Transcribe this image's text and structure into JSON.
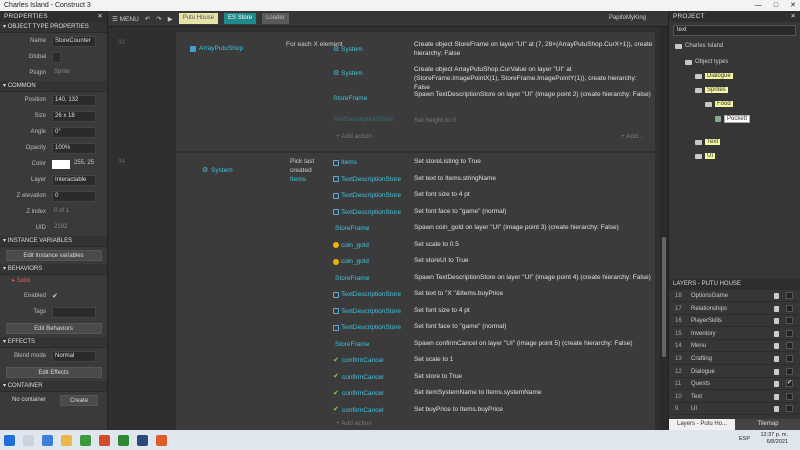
{
  "window": {
    "title": "Charles Island - Construct 3",
    "controls": [
      "—",
      "□",
      "✕"
    ]
  },
  "properties": {
    "header": "PROPERTIES",
    "sections": {
      "object_type": "OBJECT TYPE PROPERTIES",
      "common": "COMMON",
      "instance_vars": "INSTANCE VARIABLES",
      "behaviors": "BEHAVIORS",
      "effects": "EFFECTS",
      "container": "CONTAINER"
    },
    "name_label": "Name",
    "name_value": "StoreCounter",
    "global_label": "Global",
    "plugin_label": "Plugin",
    "plugin_value": "Sprite",
    "position_label": "Position",
    "position_value": "140, 132",
    "size_label": "Size",
    "size_value": "26 x 18",
    "angle_label": "Angle",
    "angle_value": "0°",
    "opacity_label": "Opacity",
    "opacity_value": "100%",
    "color_label": "Color",
    "color_value": "255, 25",
    "layer_label": "Layer",
    "layer_value": "Interactable",
    "zelev_label": "Z elevation",
    "zelev_value": "0",
    "zindex_label": "Z index",
    "zindex_value": "0 of 1",
    "uid_label": "UID",
    "uid_value": "2192",
    "edit_instance_vars": "Edit Instance variables",
    "behavior_name": "Solid",
    "enabled_label": "Enabled",
    "tags_label": "Tags",
    "edit_behaviors": "Edit Behaviors",
    "blend_label": "Blend mode",
    "blend_value": "Normal",
    "edit_effects": "Edit Effects",
    "no_container": "No container",
    "create": "Create"
  },
  "toolbar": {
    "menu": "MENU",
    "tabs": [
      "Putu House",
      "ES Store",
      "Loader"
    ],
    "user": "PapitoMyKing"
  },
  "events": {
    "ev33_num": "33",
    "ev34_num": "34",
    "ev33_cond_object": "ArrayPutuShop",
    "ev33_cond_text": "For each X element",
    "ev34_cond_object": "System",
    "ev34_cond_text": "Pick last created",
    "ev34_cond_target": "Items",
    "add_action": "+ Add action",
    "add": "+ Add...",
    "ev33_actions": [
      {
        "object": "System",
        "text": "Create object StoreFrame on layer \"UI\" at (7, 28×(ArrayPutuShop.CurX+1)), create hierarchy: False"
      },
      {
        "object": "System",
        "text": "Create object ArrayPutuShop.CurValue on layer \"UI\" at (StoreFrame.ImagePointX(1), StoreFrame.ImagePointY(1)), create hierarchy: False"
      },
      {
        "object": "StoreFrame",
        "text": "Spawn TextDescriptionStore on layer \"UI\" (image point 2) (create hierarchy: False)"
      },
      {
        "object": "TextDescriptionStore",
        "text": "Set height to 0"
      }
    ],
    "ev34_actions": [
      {
        "object": "Items",
        "text": "Set storeListing to True"
      },
      {
        "object": "TextDescriptionStore",
        "text": "Set text to Items.stringName"
      },
      {
        "object": "TextDescriptionStore",
        "text": "Set font size to 4 pt"
      },
      {
        "object": "TextDescriptionStore",
        "text": "Set font face to \"game\" (normal)"
      },
      {
        "object": "StoreFrame",
        "text": "Spawn coin_gold on layer \"UI\" (image point 3) (create hierarchy: False)"
      },
      {
        "object": "coin_gold",
        "text": "Set scale to 0.5"
      },
      {
        "object": "coin_gold",
        "text": "Set storeUI to True"
      },
      {
        "object": "StoreFrame",
        "text": "Spawn TextDescriptionStore on layer \"UI\" (image point 4) (create hierarchy: False)"
      },
      {
        "object": "TextDescriptionStore",
        "text": "Set text to \"X \"&Items.buyPrice"
      },
      {
        "object": "TextDescriptionStore",
        "text": "Set font size to 4 pt"
      },
      {
        "object": "TextDescriptionStore",
        "text": "Set font face to \"game\" (normal)"
      },
      {
        "object": "StoreFrame",
        "text": "Spawn confirmCancel on layer \"UI\" (image point 5) (create hierarchy: False)"
      },
      {
        "object": "confirmCancel",
        "text": "Set scale to 1"
      },
      {
        "object": "confirmCancel",
        "text": "Set store to True"
      },
      {
        "object": "confirmCancel",
        "text": "Set itemSystemName to Items.systemName"
      },
      {
        "object": "confirmCancel",
        "text": "Set buyPrice to Items.buyPrice"
      }
    ]
  },
  "project": {
    "header": "PROJECT",
    "search": "text",
    "root": "Charles Island",
    "object_types": "Object types",
    "dialogue": "Dialogue",
    "sprites": "Sprites",
    "food": "Food",
    "pockett": "Pockett",
    "text": "Text",
    "ui": "UI"
  },
  "layers": {
    "header": "LAYERS - PUTU HOUSE",
    "items": [
      {
        "n": "18",
        "name": "OptionsGame"
      },
      {
        "n": "17",
        "name": "Relationships"
      },
      {
        "n": "16",
        "name": "PlayerSkills"
      },
      {
        "n": "15",
        "name": "Inventory"
      },
      {
        "n": "14",
        "name": "Menu"
      },
      {
        "n": "13",
        "name": "Crafting"
      },
      {
        "n": "12",
        "name": "Dialogue"
      },
      {
        "n": "11",
        "name": "Quests"
      },
      {
        "n": "10",
        "name": "Text"
      },
      {
        "n": "9",
        "name": "UI"
      }
    ],
    "tab_layers": "Layers - Putu Ho...",
    "tab_tilemap": "Tilemap"
  },
  "taskbar": {
    "time": "12:37 p. m.",
    "date": "6/8/2021",
    "lang": "ESP"
  }
}
